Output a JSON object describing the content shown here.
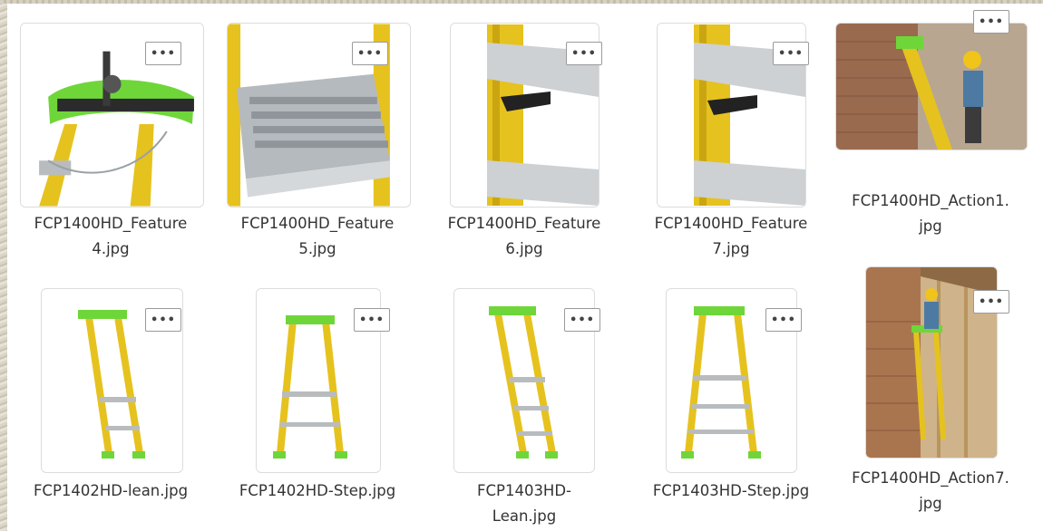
{
  "grid": {
    "more_label": "•••",
    "files": [
      {
        "name_line1": "FCP1400HD_Feature",
        "name_line2": "4.jpg",
        "thumb": "feature-4-thumbnail"
      },
      {
        "name_line1": "FCP1400HD_Feature",
        "name_line2": "5.jpg",
        "thumb": "feature-5-thumbnail"
      },
      {
        "name_line1": "FCP1400HD_Feature",
        "name_line2": "6.jpg",
        "thumb": "feature-6-thumbnail"
      },
      {
        "name_line1": "FCP1400HD_Feature",
        "name_line2": "7.jpg",
        "thumb": "feature-7-thumbnail"
      },
      {
        "name_line1": "FCP1400HD_Action1.",
        "name_line2": "jpg",
        "thumb": "action-1-thumbnail"
      },
      {
        "name_line1": "FCP1402HD-lean.jpg",
        "name_line2": "",
        "thumb": "ladder-1402-lean-thumbnail"
      },
      {
        "name_line1": "FCP1402HD-Step.jpg",
        "name_line2": "",
        "thumb": "ladder-1402-step-thumbnail"
      },
      {
        "name_line1": "FCP1403HD-",
        "name_line2": "Lean.jpg",
        "thumb": "ladder-1403-lean-thumbnail"
      },
      {
        "name_line1": "FCP1403HD-Step.jpg",
        "name_line2": "",
        "thumb": "ladder-1403-step-thumbnail"
      },
      {
        "name_line1": "FCP1400HD_Action7.",
        "name_line2": "jpg",
        "thumb": "action-7-thumbnail"
      }
    ]
  },
  "colors": {
    "fiberglass_yellow": "#e6c21e",
    "accent_green": "#6fd63a",
    "aluminum": "#c7cbce",
    "brick": "#9a6a4e"
  }
}
